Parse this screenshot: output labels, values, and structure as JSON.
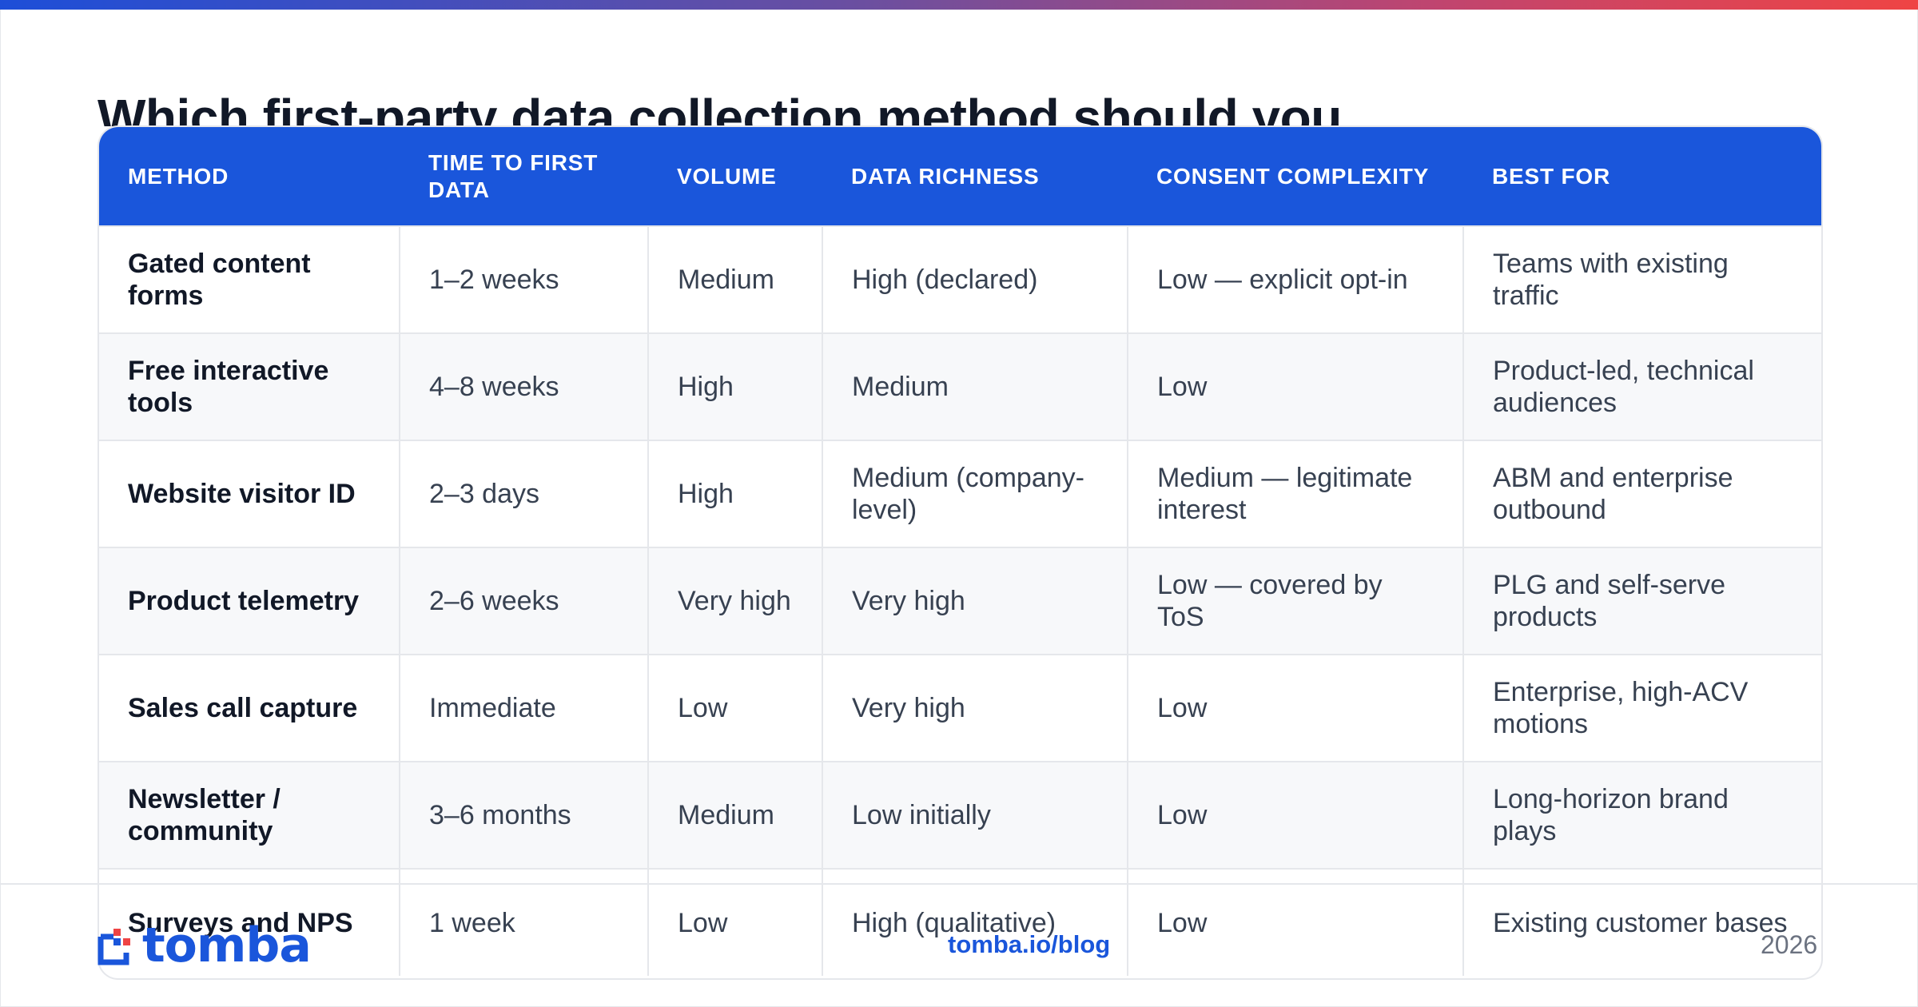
{
  "title": "Which first-party data collection method should you",
  "table": {
    "headers": [
      "METHOD",
      "TIME TO FIRST DATA",
      "VOLUME",
      "DATA RICHNESS",
      "CONSENT COMPLEXITY",
      "BEST FOR"
    ],
    "rows": [
      [
        "Gated content forms",
        "1–2 weeks",
        "Medium",
        "High (declared)",
        "Low — explicit opt-in",
        "Teams with existing traffic"
      ],
      [
        "Free interactive tools",
        "4–8 weeks",
        "High",
        "Medium",
        "Low",
        "Product-led, technical audiences"
      ],
      [
        "Website visitor ID",
        "2–3 days",
        "High",
        "Medium (company-level)",
        "Medium — legitimate interest",
        "ABM and enterprise outbound"
      ],
      [
        "Product telemetry",
        "2–6 weeks",
        "Very high",
        "Very high",
        "Low — covered by ToS",
        "PLG and self-serve products"
      ],
      [
        "Sales call capture",
        "Immediate",
        "Low",
        "Very high",
        "Low",
        "Enterprise, high-ACV motions"
      ],
      [
        "Newsletter / community",
        "3–6 months",
        "Medium",
        "Low initially",
        "Low",
        "Long-horizon brand plays"
      ],
      [
        "Surveys and NPS",
        "1 week",
        "Low",
        "High (qualitative)",
        "Low",
        "Existing customer bases"
      ]
    ]
  },
  "footer": {
    "logo_text": "tomba",
    "site": "tomba.io/blog",
    "year": "2026"
  },
  "colors": {
    "accent": "#1a56db",
    "header_bg": "#1a56db",
    "row_alt": "#f7f8fa",
    "gradient_start": "#1d4ed8",
    "gradient_end": "#ef4444"
  }
}
